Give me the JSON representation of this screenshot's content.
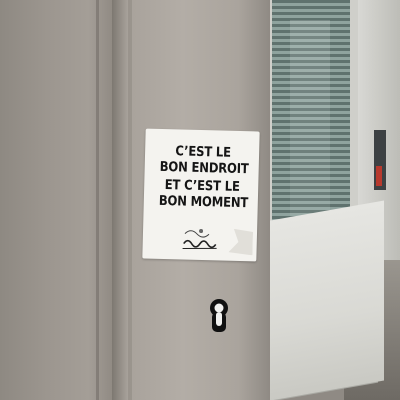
{
  "scene": {
    "sticker": {
      "lines": [
        "C’EST LE",
        "BON ENDROIT",
        "ET C’EST LE",
        "BON MOMENT"
      ]
    }
  }
}
